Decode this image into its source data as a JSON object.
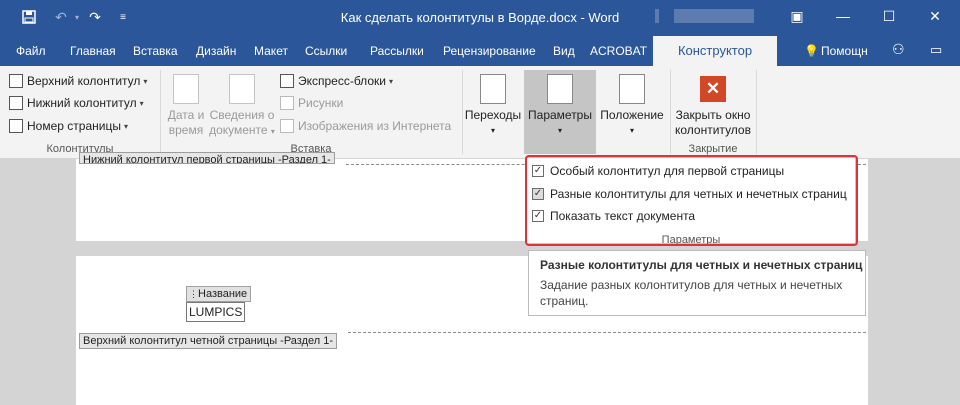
{
  "titlebar": {
    "title": "Как сделать колонтитулы в Ворде.docx - Word",
    "save_icon": "save-icon",
    "undo_icon": "undo-icon",
    "redo_icon": "redo-icon",
    "customize_icon": "customize-qat-icon",
    "minimize": "—",
    "maximize": "☐",
    "close": "✕",
    "ribbon_display": "▣"
  },
  "tabs": [
    "Файл",
    "Главная",
    "Вставка",
    "Дизайн",
    "Макет",
    "Ссылки",
    "Рассылки",
    "Рецензирование",
    "Вид",
    "ACROBAT"
  ],
  "active_tab": "Конструктор",
  "help": "Помощн",
  "ribbon": {
    "kolontituly": {
      "header": "Верхний колонтитул",
      "footer": "Нижний колонтитул",
      "page_number": "Номер страницы",
      "label": "Колонтитулы"
    },
    "vstavka": {
      "date_time_1": "Дата и",
      "date_time_2": "время",
      "doc_info_1": "Сведения о",
      "doc_info_2": "документе",
      "express": "Экспресс-блоки",
      "pictures": "Рисунки",
      "online_pictures": "Изображения из Интернета",
      "label": "Вставка"
    },
    "navigation": {
      "label": "Переходы",
      "params": "Параметры",
      "position": "Положение"
    },
    "zakrytie": {
      "close_1": "Закрыть окно",
      "close_2": "колонтитулов",
      "label": "Закрытие"
    }
  },
  "dropdown": {
    "items": [
      {
        "label": "Особый колонтитул для первой страницы",
        "checked": true
      },
      {
        "label": "Разные колонтитулы для четных и нечетных страниц",
        "checked": true
      },
      {
        "label": "Показать текст документа",
        "checked": true
      }
    ],
    "group_label": "Параметры"
  },
  "tooltip": {
    "title": "Разные колонтитулы для четных и нечетных страниц",
    "description": "Задание разных колонтитулов для четных и нечетных страниц."
  },
  "document": {
    "footer_first_label": "Нижний колонтитул первой страницы -Раздел 1-",
    "field_tag": "Название",
    "field_value": "LUMPICS",
    "header_even_label": "Верхний колонтитул четной страницы -Раздел 1-"
  }
}
